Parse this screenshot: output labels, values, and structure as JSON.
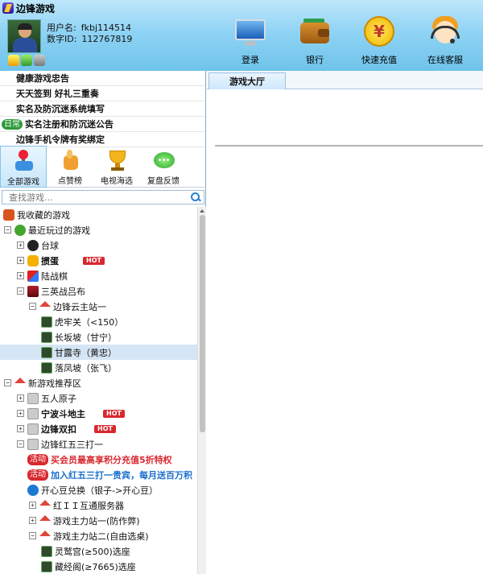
{
  "app": {
    "title": "边锋游戏"
  },
  "user": {
    "name_label": "用户名:",
    "name": "fkbj114514",
    "id_label": "数字ID:",
    "id": "112767819"
  },
  "toolbar": [
    {
      "label": "登录",
      "icon": "monitor-icon"
    },
    {
      "label": "银行",
      "icon": "wallet-icon"
    },
    {
      "label": "快速充值",
      "icon": "yuan-coin-icon"
    },
    {
      "label": "在线客服",
      "icon": "customer-service-icon"
    }
  ],
  "promos": [
    {
      "text": "健康游戏忠告"
    },
    {
      "text": "天天签到 好礼三重奏"
    },
    {
      "text": "实名及防沉迷系统填写"
    },
    {
      "badge": "日常",
      "text": "实名注册和防沉迷公告"
    },
    {
      "text": "边锋手机令牌有奖绑定"
    }
  ],
  "categories": [
    {
      "label": "全部游戏",
      "icon": "joystick-icon"
    },
    {
      "label": "点赞榜",
      "icon": "thumbs-up-icon"
    },
    {
      "label": "电视海选",
      "icon": "trophy-icon"
    },
    {
      "label": "复盘反馈",
      "icon": "chat-bubble-icon"
    }
  ],
  "search": {
    "placeholder": "查找游戏..."
  },
  "hot_badge": "HOT",
  "activity_badge": "活动",
  "tree": [
    {
      "label": "我收藏的游戏"
    },
    {
      "label": "最近玩过的游戏"
    },
    {
      "label": "台球"
    },
    {
      "label": "掼蛋"
    },
    {
      "label": "陆战棋"
    },
    {
      "label": "三英战吕布"
    },
    {
      "label": "边锋云主站一"
    },
    {
      "label": "虎牢关（<150）"
    },
    {
      "label": "长坂坡（甘宁）"
    },
    {
      "label": "甘露寺（黄忠）"
    },
    {
      "label": "落凤坡（张飞）"
    },
    {
      "label": "新游戏推荐区"
    },
    {
      "label": "五人原子"
    },
    {
      "label": "宁波斗地主"
    },
    {
      "label": "边锋双扣"
    },
    {
      "label": "边锋红五三打一"
    },
    {
      "label": "买会员最高享积分充值5折特权"
    },
    {
      "label": "加入红五三打一贵宾，每月送百万积"
    },
    {
      "label": "开心豆兑换（银子->开心豆）"
    },
    {
      "label": "红ＩＩ互通服务器"
    },
    {
      "label": "游戏主力站一(防作弊)"
    },
    {
      "label": "游戏主力站二(自由选桌)"
    },
    {
      "label": "灵鹫宫(≥500)选座"
    },
    {
      "label": "藏经阁(≥7665)选座"
    }
  ],
  "tabs": {
    "lobby": "游戏大厅"
  }
}
